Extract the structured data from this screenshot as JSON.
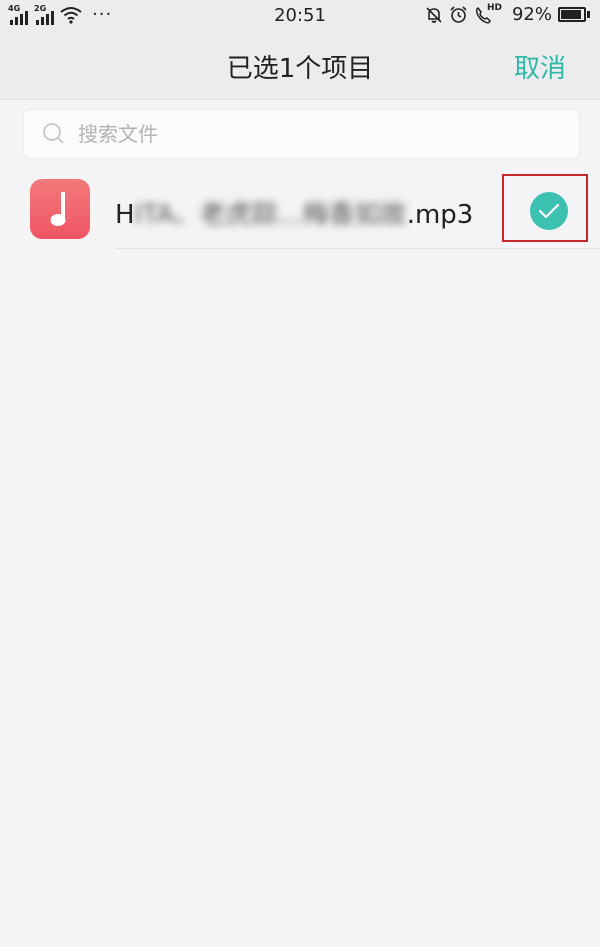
{
  "status_bar": {
    "network_1": "4G",
    "network_2": "2G",
    "time": "20:51",
    "battery_percent": "92%",
    "battery_level": 0.92,
    "more_dots": "···",
    "hd_label": "HD"
  },
  "nav": {
    "title": "已选1个项目",
    "cancel_label": "取消"
  },
  "search": {
    "placeholder": "搜索文件"
  },
  "files": [
    {
      "name_start": "H",
      "name_blurred": "ITA、老虎踪...梅香如故",
      "name_end": ".mp3",
      "selected": true,
      "icon": "music-note-icon"
    }
  ],
  "colors": {
    "accent": "#2fb8a8",
    "check": "#3cc1b1",
    "icon_gradient_top": "#f57a7c",
    "icon_gradient_bottom": "#ee5563",
    "highlight_box": "#c4262c"
  }
}
